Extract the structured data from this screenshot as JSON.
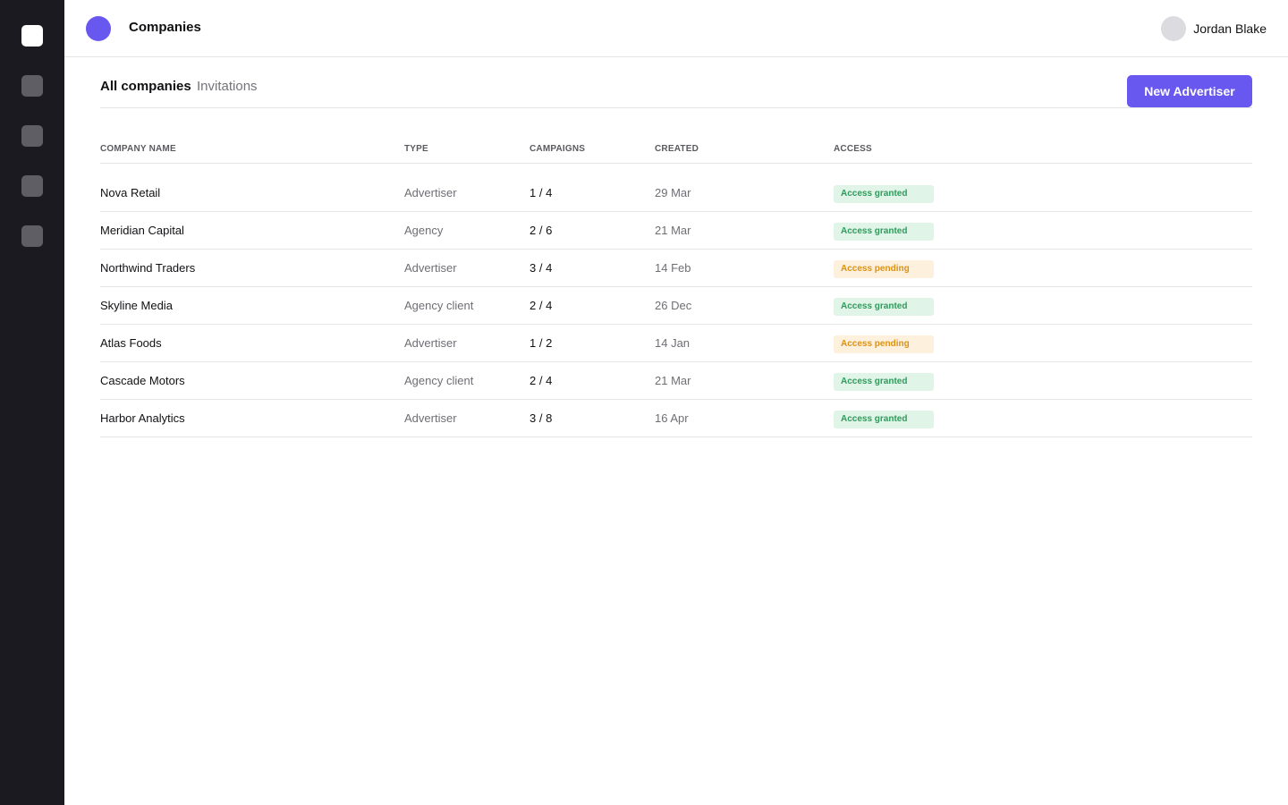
{
  "header": {
    "title": "Companies",
    "user_name": "Jordan Blake"
  },
  "tabs": [
    {
      "label": "All companies",
      "active": true
    },
    {
      "label": "Invitations",
      "active": false
    }
  ],
  "actions": {
    "new_advertiser_label": "New Advertiser"
  },
  "table": {
    "columns": [
      "COMPANY NAME",
      "TYPE",
      "CAMPAIGNS",
      "CREATED",
      "ACCESS"
    ],
    "rows": [
      {
        "name": "Nova Retail",
        "type": "Advertiser",
        "campaigns": "1 / 4",
        "created": "29 Mar",
        "access": "Access granted",
        "status": "granted"
      },
      {
        "name": "Meridian Capital",
        "type": "Agency",
        "campaigns": "2 / 6",
        "created": "21 Mar",
        "access": "Access granted",
        "status": "granted"
      },
      {
        "name": "Northwind Traders",
        "type": "Advertiser",
        "campaigns": "3 / 4",
        "created": "14 Feb",
        "access": "Access pending",
        "status": "pending"
      },
      {
        "name": "Skyline Media",
        "type": "Agency client",
        "campaigns": "2 / 4",
        "created": "26 Dec",
        "access": "Access granted",
        "status": "granted"
      },
      {
        "name": "Atlas Foods",
        "type": "Advertiser",
        "campaigns": "1 / 2",
        "created": "14 Jan",
        "access": "Access pending",
        "status": "pending"
      },
      {
        "name": "Cascade Motors",
        "type": "Agency client",
        "campaigns": "2 / 4",
        "created": "21 Mar",
        "access": "Access granted",
        "status": "granted"
      },
      {
        "name": "Harbor Analytics",
        "type": "Advertiser",
        "campaigns": "3 / 8",
        "created": "16 Apr",
        "access": "Access granted",
        "status": "granted"
      }
    ]
  },
  "colors": {
    "accent": "#6858f0",
    "sidebar_bg": "#1b1a20",
    "granted_bg": "#e1f4e8",
    "granted_text": "#2f9b5c",
    "pending_bg": "#fdf0dd",
    "pending_text": "#dc9214"
  }
}
